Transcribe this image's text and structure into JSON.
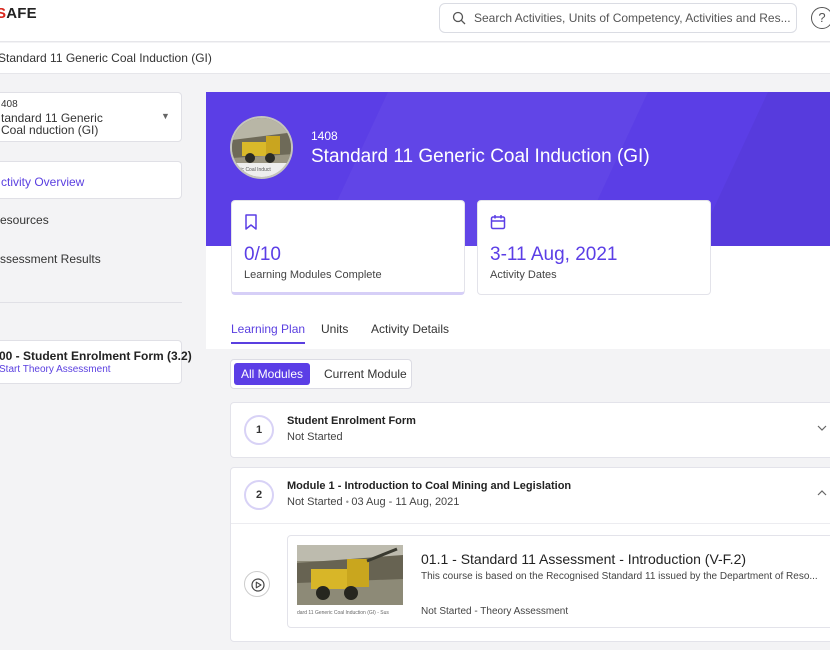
{
  "app": {
    "logo_prefix": "S",
    "logo_suffix": "AFE",
    "search_placeholder": "Search Activities, Units of Competency, Activities and Res...",
    "help_label": "?"
  },
  "breadcrumb": {
    "text": "Standard 11 Generic Coal Induction (GI)"
  },
  "sidebar": {
    "selector": {
      "code": "408",
      "name": "tandard 11 Generic Coal nduction (GI)"
    },
    "items": [
      {
        "label": "ctivity Overview",
        "active": true
      },
      {
        "label": "esources",
        "active": false
      },
      {
        "label": "ssessment Results",
        "active": false
      }
    ],
    "pending": {
      "title": "00 - Student Enrolment Form (3.2)",
      "action": "Start Theory Assessment"
    }
  },
  "hero": {
    "code": "1408",
    "title": "Standard 11 Generic Coal Induction (GI)",
    "avatar_caption": "eric Coal Induct",
    "colors": {
      "accent": "#5b3ee6"
    }
  },
  "stats": [
    {
      "icon": "bookmark-icon",
      "value": "0/10",
      "label": "Learning Modules Complete"
    },
    {
      "icon": "calendar-icon",
      "value": "3-11 Aug, 2021",
      "label": "Activity Dates"
    }
  ],
  "tabs": [
    {
      "label": "Learning Plan",
      "active": true
    },
    {
      "label": "Units",
      "active": false
    },
    {
      "label": "Activity Details",
      "active": false
    }
  ],
  "filter": {
    "all": "All Modules",
    "current": "Current Module"
  },
  "modules": [
    {
      "number": "1",
      "title": "Student Enrolment Form",
      "status": "Not Started",
      "dates": "",
      "expanded": false
    },
    {
      "number": "2",
      "title": "Module 1 - Introduction to Coal Mining and Legislation",
      "status": "Not Started",
      "dates": "03 Aug - 11 Aug, 2021",
      "expanded": true
    }
  ],
  "course": {
    "title": "01.1 - Standard 11 Assessment - Introduction (V-F.2)",
    "description": "This course is based on the Recognised Standard 11 issued by the Department of Reso...",
    "status": "Not Started - Theory Assessment",
    "thumb_caption": "dard 11 Generic Coal Induction (GI) - Sus"
  }
}
